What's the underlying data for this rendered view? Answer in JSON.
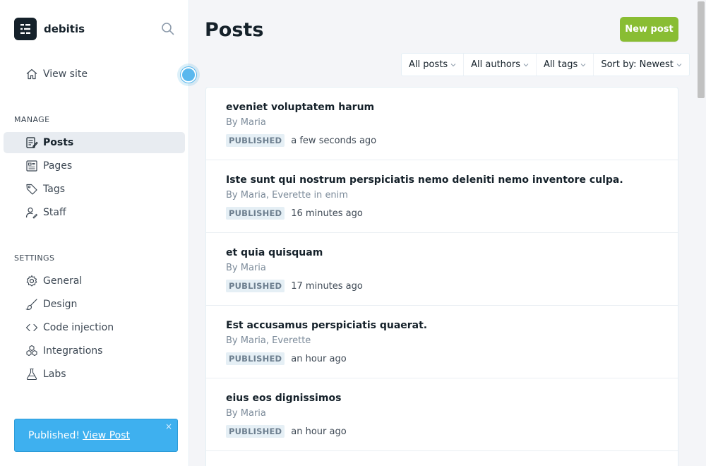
{
  "sidebar": {
    "brand": {
      "name": "debitis"
    },
    "view_site": "View site",
    "manage_label": "MANAGE",
    "manage_items": [
      {
        "label": "Posts",
        "icon": "posts-icon",
        "active": true
      },
      {
        "label": "Pages",
        "icon": "pages-icon"
      },
      {
        "label": "Tags",
        "icon": "tag-icon"
      },
      {
        "label": "Staff",
        "icon": "staff-icon"
      }
    ],
    "settings_label": "SETTINGS",
    "settings_items": [
      {
        "label": "General",
        "icon": "gear-icon"
      },
      {
        "label": "Design",
        "icon": "brush-icon"
      },
      {
        "label": "Code injection",
        "icon": "code-icon"
      },
      {
        "label": "Integrations",
        "icon": "integrations-icon"
      },
      {
        "label": "Labs",
        "icon": "flask-icon"
      }
    ],
    "toast": {
      "text": "Published!",
      "link": "View Post",
      "close": "×"
    }
  },
  "main": {
    "title": "Posts",
    "new_post": "New post",
    "filters": {
      "type": "All posts",
      "authors": "All authors",
      "tags": "All tags",
      "sort": "Sort by: Newest"
    },
    "posts": [
      {
        "title": "eveniet voluptatem harum",
        "by": "By",
        "authors": "Maria",
        "in": "",
        "tag": "",
        "status": "PUBLISHED",
        "time": "a few seconds ago"
      },
      {
        "title": "Iste sunt qui nostrum perspiciatis nemo deleniti nemo inventore culpa.",
        "by": "By",
        "authors": "Maria, Everette",
        "in": "in",
        "tag": "enim",
        "status": "PUBLISHED",
        "time": "16 minutes ago"
      },
      {
        "title": "et quia quisquam",
        "by": "By",
        "authors": "Maria",
        "in": "",
        "tag": "",
        "status": "PUBLISHED",
        "time": "17 minutes ago"
      },
      {
        "title": "Est accusamus perspiciatis quaerat.",
        "by": "By",
        "authors": "Maria, Everette",
        "in": "",
        "tag": "",
        "status": "PUBLISHED",
        "time": "an hour ago"
      },
      {
        "title": "eius eos dignissimos",
        "by": "By",
        "authors": "Maria",
        "in": "",
        "tag": "",
        "status": "PUBLISHED",
        "time": "an hour ago"
      }
    ]
  },
  "colors": {
    "accent_green": "#89bd33",
    "toast_blue": "#3eb0ef",
    "sidebar_active": "#e8ecf1",
    "text_dark": "#15212a"
  }
}
